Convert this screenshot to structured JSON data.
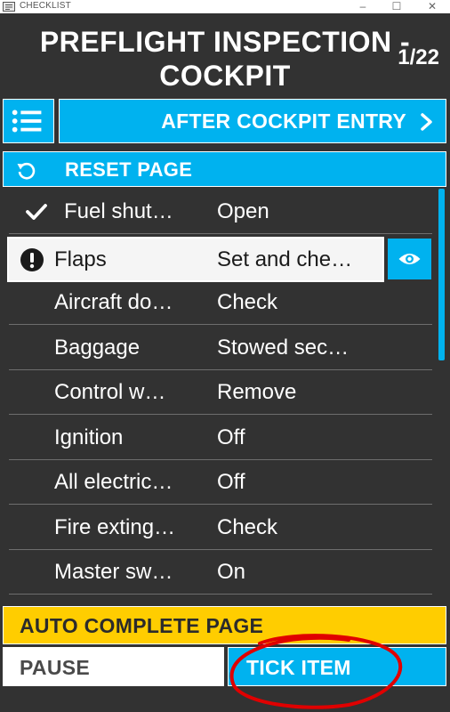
{
  "window": {
    "title": "CHECKLIST",
    "minimize_glyph": "–",
    "maximize_glyph": "☐",
    "close_glyph": "✕"
  },
  "header": {
    "title_line1": "PREFLIGHT INSPECTION -",
    "title_line2": "COCKPIT",
    "page_indicator": "1/22"
  },
  "navigation": {
    "menu_icon": "list-icon",
    "next_label": "AFTER COCKPIT ENTRY",
    "next_icon": "chevron-right-icon"
  },
  "reset": {
    "label": "RESET PAGE",
    "icon": "reset-icon"
  },
  "checklist": {
    "items": [
      {
        "item": "Fuel shut…",
        "value": "Open",
        "state": "checked"
      },
      {
        "item": "Flaps",
        "value": "Set and che…",
        "state": "current"
      },
      {
        "item": "Aircraft do…",
        "value": "Check",
        "state": "pending"
      },
      {
        "item": "Baggage",
        "value": "Stowed sec…",
        "state": "pending"
      },
      {
        "item": "Control w…",
        "value": "Remove",
        "state": "pending"
      },
      {
        "item": "Ignition",
        "value": "Off",
        "state": "pending"
      },
      {
        "item": "All electric…",
        "value": "Off",
        "state": "pending"
      },
      {
        "item": "Fire exting…",
        "value": "Check",
        "state": "pending"
      },
      {
        "item": "Master sw…",
        "value": "On",
        "state": "pending"
      }
    ],
    "scroll_position": 0
  },
  "footer": {
    "auto_complete_label": "AUTO COMPLETE PAGE",
    "pause_label": "PAUSE",
    "tick_label": "TICK ITEM"
  },
  "colors": {
    "background": "#323232",
    "accent": "#00b2ef",
    "warning": "#ffcd00",
    "annotation": "#e00000"
  }
}
